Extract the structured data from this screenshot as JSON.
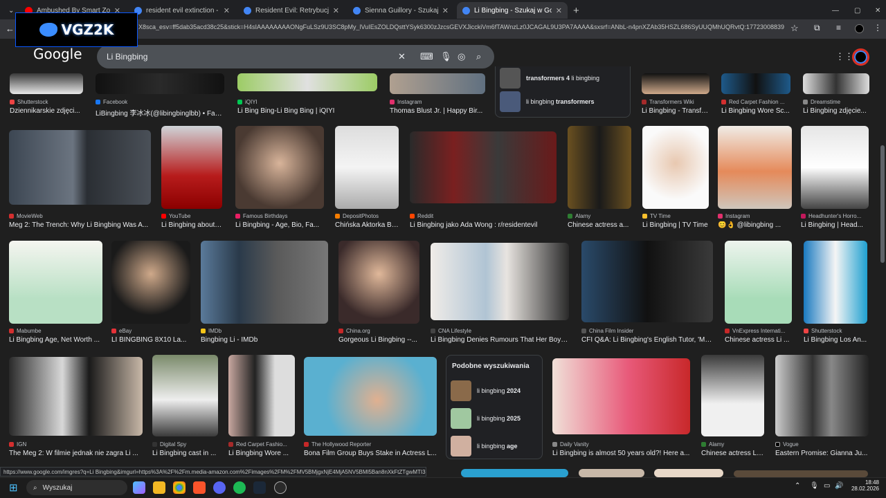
{
  "tabs": [
    {
      "title": "Ambushed By Smart Zombies | l",
      "color": "#ff0000"
    },
    {
      "title": "resident evil extinction - Szukaj",
      "color": "#4285f4"
    },
    {
      "title": "Resident Evil: Retrybucja - Szuk",
      "color": "#4285f4"
    },
    {
      "title": "Sienna Guillory - Szukaj w Goog",
      "color": "#4285f4"
    },
    {
      "title": "Li Bingbing - Szukaj w Google",
      "color": "#4285f4"
    }
  ],
  "address_bar": "X8sca_esv=ff5dab35acd38c25&stick=H4sIAAAAAAAAONgFuLSz9U3SC8pMy_lVuIEsZOLDQsttYSyk6300zJzcsGEVXJicckiVm6fTAWnzLz0JCAGAL9U3PA7AAAA&sxsrf=ANbL-n4pnXZAb35HSZL686SyUUQMhUQRvtQ:17723008839",
  "watermark": "VGZ2K",
  "google_logo": "Google",
  "search_query": "Li Bingbing",
  "results": [
    {
      "source": "Shutterstock",
      "caption": "Dziennikarskie zdjęci..."
    },
    {
      "source": "Facebook",
      "caption": "LiBingbing 李冰冰(@libingbinglbb) • Face..."
    },
    {
      "source": "iQIYI",
      "caption": "Li Bing Bing-Li Bing Bing | iQIYI"
    },
    {
      "source": "Instagram",
      "caption": "Thomas Blust Jr. | Happy Bir..."
    },
    {
      "source": "Transformers Wiki",
      "caption": "Li Bingbing - Transfo..."
    },
    {
      "source": "Red Carpet Fashion ...",
      "caption": "Li Bingbing Wore Sc..."
    },
    {
      "source": "Dreamstime",
      "caption": "Li Bingbing zdjęcie..."
    },
    {
      "source": "MovieWeb",
      "caption": "Meg 2: The Trench: Why Li Bingbing Was A..."
    },
    {
      "source": "YouTube",
      "caption": "Li Bingbing about ..."
    },
    {
      "source": "Famous Birthdays",
      "caption": "Li Bingbing - Age, Bio, Fa..."
    },
    {
      "source": "DepositPhotos",
      "caption": "Chińska Aktorka Bi..."
    },
    {
      "source": "Reddit",
      "caption": "Li Bingbing jako Ada Wong : r/residentevil"
    },
    {
      "source": "Alamy",
      "caption": "Chinese actress a..."
    },
    {
      "source": "TV Time",
      "caption": "Li Bingbing | TV Time"
    },
    {
      "source": "Instagram",
      "caption": "😊👌 @libingbing ..."
    },
    {
      "source": "Headhunter's Horro...",
      "caption": "Li Bingbing | Head..."
    },
    {
      "source": "Mabumbe",
      "caption": "Li Bingbing Age, Net Worth ..."
    },
    {
      "source": "eBay",
      "caption": "LI BINGBING 8X10 La..."
    },
    {
      "source": "IMDb",
      "caption": "Bingbing Li - IMDb"
    },
    {
      "source": "China.org",
      "caption": "Gorgeous Li Bingbing --..."
    },
    {
      "source": "CNA Lifestyle",
      "caption": "Li Bingbing Denies Rumours That Her Boyfri..."
    },
    {
      "source": "China Film Insider",
      "caption": "CFI Q&A: Li Bingbing's English Tutor, 'My..."
    },
    {
      "source": "VnExpress Internati...",
      "caption": "Chinese actress Li ..."
    },
    {
      "source": "Shutterstock",
      "caption": "Li Bingbing Los An..."
    },
    {
      "source": "IGN",
      "caption": "The Meg 2: W filmie jednak nie zagra Li ..."
    },
    {
      "source": "Digital Spy",
      "caption": "Li Bingbing cast in ..."
    },
    {
      "source": "Red Carpet Fashio...",
      "caption": "Li Bingbing Wore ..."
    },
    {
      "source": "The Hollywood Reporter",
      "caption": "Bona Film Group Buys Stake in Actress L..."
    },
    {
      "source": "Daily Vanity",
      "caption": "Li Bingbing is almost 50 years old?! Here a..."
    },
    {
      "source": "Alamy",
      "caption": "Chinese actress Li ..."
    },
    {
      "source": "Vogue",
      "caption": "Eastern Promise: Gianna Ju..."
    }
  ],
  "related_top": [
    {
      "prefix": "",
      "bold": "transformers 4",
      "suffix": " li bingbing"
    },
    {
      "prefix": "li bingbing ",
      "bold": "transformers",
      "suffix": ""
    }
  ],
  "similar": {
    "title": "Podobne wyszukiwania",
    "items": [
      {
        "prefix": "li bingbing ",
        "bold": "2024"
      },
      {
        "prefix": "li bingbing ",
        "bold": "2025"
      },
      {
        "prefix": "li bingbing ",
        "bold": "age"
      }
    ]
  },
  "status_url": "https://www.google.com/imgres?q=Li Bingbing&imgurl=https%3A%2F%2Fm.media-amazon.com%2Fimages%2FM%2FMV5BMjgxNjE4MjA5NV5BMl5Ban8nXkFtZTgwMTI3...",
  "taskbar": {
    "search": "Wyszukaj",
    "time": "18:48",
    "date": "28.02.2026"
  }
}
